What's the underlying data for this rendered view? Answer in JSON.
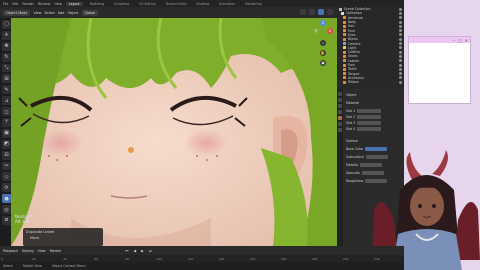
{
  "topbar": {
    "menus": [
      "File",
      "Edit",
      "Render",
      "Window",
      "Help"
    ],
    "tabs": [
      "Layout",
      "Modeling",
      "Sculpting",
      "UV Editing",
      "Texture Paint",
      "Shading",
      "Animation",
      "Rendering",
      "Compositing",
      "Scripting"
    ],
    "active_tab": "Layout"
  },
  "header": {
    "mode": "Object Mode",
    "menus": [
      "View",
      "Select",
      "Add",
      "Object"
    ],
    "transform": "Global"
  },
  "viewport": {
    "nav_title": "Numpad",
    "nav_sub": "Alt + N",
    "operator_title": "Duplicate Linked",
    "operator_value": "Move"
  },
  "outliner": {
    "rows": [
      "Scene Collection",
      "Collection",
      "Armature",
      "Body",
      "Hair",
      "Face",
      "Eyes",
      "Brows",
      "Camera",
      "Light",
      "Clothes",
      "Shoes",
      "Lashes",
      "Ears",
      "Teeth",
      "Tongue",
      "Accessory",
      "Ribbon"
    ]
  },
  "properties": {
    "section": "Object",
    "rows": [
      "Material",
      "Slot 1",
      "Slot 2",
      "Slot 3",
      "Slot 4",
      "Surface",
      "Base Color",
      "Subsurface",
      "Metallic",
      "Specular",
      "Roughness"
    ]
  },
  "timeline": {
    "menus": [
      "Playback",
      "Keying",
      "View",
      "Marker"
    ],
    "ruler": [
      "0",
      "20",
      "40",
      "60",
      "80",
      "100",
      "120",
      "140",
      "160",
      "180",
      "200",
      "220",
      "240"
    ]
  },
  "status": {
    "items": [
      "Select",
      "Rotate View",
      "Object Context Menu"
    ]
  },
  "colors": {
    "accent": "#4772b3",
    "skin": "#e9c8b6",
    "hair": "#7fae2a",
    "panel": "#2b2b2b",
    "pink_bg": "#e7d5ee"
  }
}
